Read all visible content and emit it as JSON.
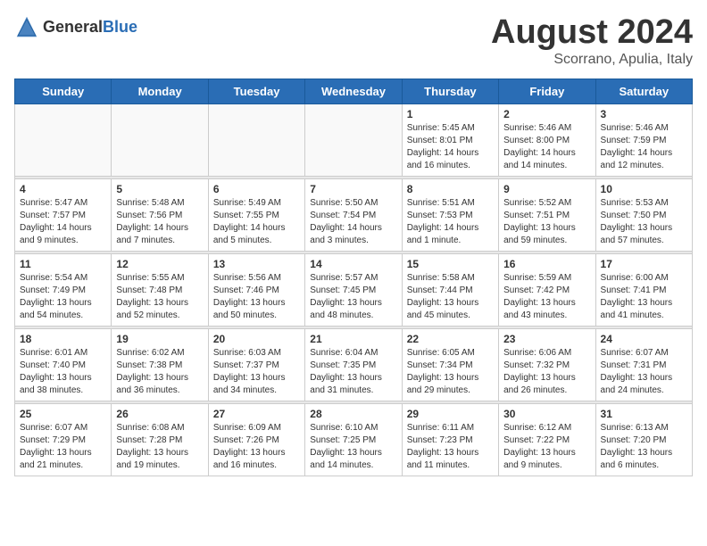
{
  "logo": {
    "text_general": "General",
    "text_blue": "Blue"
  },
  "title": "August 2024",
  "subtitle": "Scorrano, Apulia, Italy",
  "weekdays": [
    "Sunday",
    "Monday",
    "Tuesday",
    "Wednesday",
    "Thursday",
    "Friday",
    "Saturday"
  ],
  "weeks": [
    [
      {
        "day": "",
        "info": ""
      },
      {
        "day": "",
        "info": ""
      },
      {
        "day": "",
        "info": ""
      },
      {
        "day": "",
        "info": ""
      },
      {
        "day": "1",
        "info": "Sunrise: 5:45 AM\nSunset: 8:01 PM\nDaylight: 14 hours\nand 16 minutes."
      },
      {
        "day": "2",
        "info": "Sunrise: 5:46 AM\nSunset: 8:00 PM\nDaylight: 14 hours\nand 14 minutes."
      },
      {
        "day": "3",
        "info": "Sunrise: 5:46 AM\nSunset: 7:59 PM\nDaylight: 14 hours\nand 12 minutes."
      }
    ],
    [
      {
        "day": "4",
        "info": "Sunrise: 5:47 AM\nSunset: 7:57 PM\nDaylight: 14 hours\nand 9 minutes."
      },
      {
        "day": "5",
        "info": "Sunrise: 5:48 AM\nSunset: 7:56 PM\nDaylight: 14 hours\nand 7 minutes."
      },
      {
        "day": "6",
        "info": "Sunrise: 5:49 AM\nSunset: 7:55 PM\nDaylight: 14 hours\nand 5 minutes."
      },
      {
        "day": "7",
        "info": "Sunrise: 5:50 AM\nSunset: 7:54 PM\nDaylight: 14 hours\nand 3 minutes."
      },
      {
        "day": "8",
        "info": "Sunrise: 5:51 AM\nSunset: 7:53 PM\nDaylight: 14 hours\nand 1 minute."
      },
      {
        "day": "9",
        "info": "Sunrise: 5:52 AM\nSunset: 7:51 PM\nDaylight: 13 hours\nand 59 minutes."
      },
      {
        "day": "10",
        "info": "Sunrise: 5:53 AM\nSunset: 7:50 PM\nDaylight: 13 hours\nand 57 minutes."
      }
    ],
    [
      {
        "day": "11",
        "info": "Sunrise: 5:54 AM\nSunset: 7:49 PM\nDaylight: 13 hours\nand 54 minutes."
      },
      {
        "day": "12",
        "info": "Sunrise: 5:55 AM\nSunset: 7:48 PM\nDaylight: 13 hours\nand 52 minutes."
      },
      {
        "day": "13",
        "info": "Sunrise: 5:56 AM\nSunset: 7:46 PM\nDaylight: 13 hours\nand 50 minutes."
      },
      {
        "day": "14",
        "info": "Sunrise: 5:57 AM\nSunset: 7:45 PM\nDaylight: 13 hours\nand 48 minutes."
      },
      {
        "day": "15",
        "info": "Sunrise: 5:58 AM\nSunset: 7:44 PM\nDaylight: 13 hours\nand 45 minutes."
      },
      {
        "day": "16",
        "info": "Sunrise: 5:59 AM\nSunset: 7:42 PM\nDaylight: 13 hours\nand 43 minutes."
      },
      {
        "day": "17",
        "info": "Sunrise: 6:00 AM\nSunset: 7:41 PM\nDaylight: 13 hours\nand 41 minutes."
      }
    ],
    [
      {
        "day": "18",
        "info": "Sunrise: 6:01 AM\nSunset: 7:40 PM\nDaylight: 13 hours\nand 38 minutes."
      },
      {
        "day": "19",
        "info": "Sunrise: 6:02 AM\nSunset: 7:38 PM\nDaylight: 13 hours\nand 36 minutes."
      },
      {
        "day": "20",
        "info": "Sunrise: 6:03 AM\nSunset: 7:37 PM\nDaylight: 13 hours\nand 34 minutes."
      },
      {
        "day": "21",
        "info": "Sunrise: 6:04 AM\nSunset: 7:35 PM\nDaylight: 13 hours\nand 31 minutes."
      },
      {
        "day": "22",
        "info": "Sunrise: 6:05 AM\nSunset: 7:34 PM\nDaylight: 13 hours\nand 29 minutes."
      },
      {
        "day": "23",
        "info": "Sunrise: 6:06 AM\nSunset: 7:32 PM\nDaylight: 13 hours\nand 26 minutes."
      },
      {
        "day": "24",
        "info": "Sunrise: 6:07 AM\nSunset: 7:31 PM\nDaylight: 13 hours\nand 24 minutes."
      }
    ],
    [
      {
        "day": "25",
        "info": "Sunrise: 6:07 AM\nSunset: 7:29 PM\nDaylight: 13 hours\nand 21 minutes."
      },
      {
        "day": "26",
        "info": "Sunrise: 6:08 AM\nSunset: 7:28 PM\nDaylight: 13 hours\nand 19 minutes."
      },
      {
        "day": "27",
        "info": "Sunrise: 6:09 AM\nSunset: 7:26 PM\nDaylight: 13 hours\nand 16 minutes."
      },
      {
        "day": "28",
        "info": "Sunrise: 6:10 AM\nSunset: 7:25 PM\nDaylight: 13 hours\nand 14 minutes."
      },
      {
        "day": "29",
        "info": "Sunrise: 6:11 AM\nSunset: 7:23 PM\nDaylight: 13 hours\nand 11 minutes."
      },
      {
        "day": "30",
        "info": "Sunrise: 6:12 AM\nSunset: 7:22 PM\nDaylight: 13 hours\nand 9 minutes."
      },
      {
        "day": "31",
        "info": "Sunrise: 6:13 AM\nSunset: 7:20 PM\nDaylight: 13 hours\nand 6 minutes."
      }
    ]
  ]
}
